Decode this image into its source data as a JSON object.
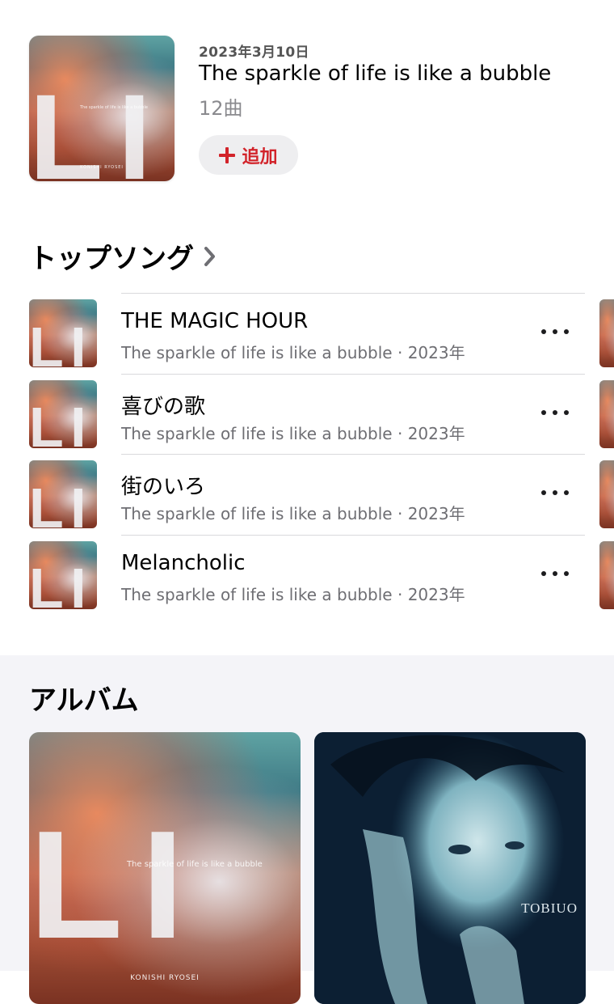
{
  "release": {
    "date": "2023年3月10日",
    "title": "The sparkle of life is like a bubble",
    "track_count": "12曲",
    "add_label": "追加",
    "add_icon": "plus-icon",
    "art_title": "The sparkle of life is like a bubble",
    "art_artist": "KONISHI RYOSEI"
  },
  "top_songs": {
    "heading": "トップソング",
    "chevron_icon": "chevron-right-icon",
    "items": [
      {
        "title": "THE MAGIC HOUR",
        "subtitle": "The sparkle of life is like a bubble · 2023年"
      },
      {
        "title": "喜びの歌",
        "subtitle": "The sparkle of life is like a bubble · 2023年"
      },
      {
        "title": "街のいろ",
        "subtitle": "The sparkle of life is like a bubble · 2023年"
      },
      {
        "title": "Melancholic",
        "subtitle": "The sparkle of life is like a bubble · 2023年"
      }
    ],
    "more_icon": "ellipsis-icon"
  },
  "albums": {
    "heading": "アルバム",
    "items": [
      {
        "art_caption": "The sparkle of life is like a bubble",
        "art_artist": "KONISHI RYOSEI"
      },
      {
        "art_text": "TOBIUO"
      }
    ]
  },
  "colors": {
    "accent": "#d2232a",
    "secondary_text": "#6e6e73",
    "album_section_bg": "#f4f4f8"
  }
}
